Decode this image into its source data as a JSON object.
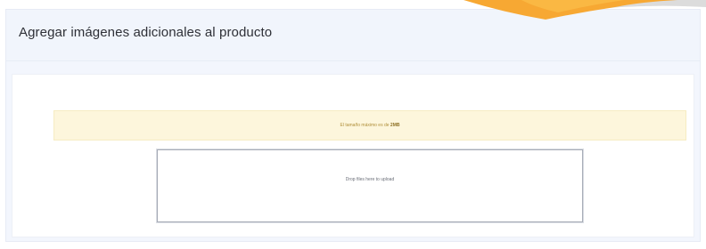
{
  "card": {
    "title": "Agregar imágenes adicionales al producto"
  },
  "notice": {
    "text": "El tamaño máximo es de",
    "emphasis": "2MB"
  },
  "dropzone": {
    "message": "Drop files here to upload"
  },
  "colors": {
    "card_background": "#f3f6fd",
    "notice_background": "#fdf6dc",
    "notice_text": "#b08f3a",
    "dropzone_border": "#a7acb7",
    "decor_orange": "#f7a833",
    "decor_gray": "#dcdcdc"
  },
  "icons": {
    "corner_decoration": "orange-swoosh-decoration"
  }
}
